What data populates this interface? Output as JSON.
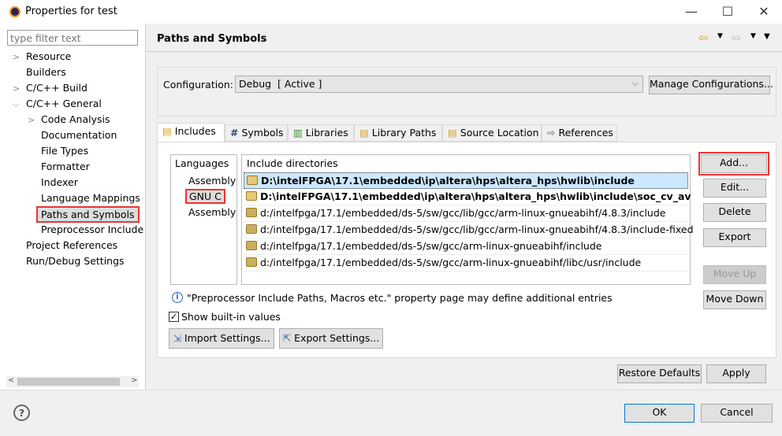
{
  "window": {
    "title": "Properties for test"
  },
  "filter": {
    "placeholder": "type filter text"
  },
  "tree": [
    {
      "label": "Resource",
      "level": 0,
      "chevron": "right"
    },
    {
      "label": "Builders",
      "level": 0,
      "chevron": ""
    },
    {
      "label": "C/C++ Build",
      "level": 0,
      "chevron": "right"
    },
    {
      "label": "C/C++ General",
      "level": 0,
      "chevron": "down"
    },
    {
      "label": "Code Analysis",
      "level": 1,
      "chevron": "right"
    },
    {
      "label": "Documentation",
      "level": 1,
      "chevron": ""
    },
    {
      "label": "File Types",
      "level": 1,
      "chevron": ""
    },
    {
      "label": "Formatter",
      "level": 1,
      "chevron": ""
    },
    {
      "label": "Indexer",
      "level": 1,
      "chevron": ""
    },
    {
      "label": "Language Mappings",
      "level": 1,
      "chevron": ""
    },
    {
      "label": "Paths and Symbols",
      "level": 1,
      "chevron": "",
      "selected": true
    },
    {
      "label": "Preprocessor Include",
      "level": 1,
      "chevron": ""
    },
    {
      "label": "Project References",
      "level": 0,
      "chevron": ""
    },
    {
      "label": "Run/Debug Settings",
      "level": 0,
      "chevron": ""
    }
  ],
  "page": {
    "title": "Paths and Symbols"
  },
  "config": {
    "label": "Configuration:",
    "value": "Debug  [ Active ]",
    "manage": "Manage Configurations..."
  },
  "tabs": [
    "Includes",
    "Symbols",
    "Libraries",
    "Library Paths",
    "Source Location",
    "References"
  ],
  "languages": {
    "header": "Languages",
    "items": [
      "Assembly",
      "GNU C",
      "Assembly"
    ]
  },
  "includes": {
    "header": "Include directories",
    "rows": [
      {
        "path": "D:\\intelFPGA\\17.1\\embedded\\ip\\altera\\hps\\altera_hps\\hwlib\\include",
        "bold": true
      },
      {
        "path": "D:\\intelFPGA\\17.1\\embedded\\ip\\altera\\hps\\altera_hps\\hwlib\\include\\soc_cv_av",
        "bold": true
      },
      {
        "path": "d:/intelfpga/17.1/embedded/ds-5/sw/gcc/lib/gcc/arm-linux-gnueabihf/4.8.3/include",
        "bold": false
      },
      {
        "path": "d:/intelfpga/17.1/embedded/ds-5/sw/gcc/lib/gcc/arm-linux-gnueabihf/4.8.3/include-fixed",
        "bold": false
      },
      {
        "path": "d:/intelfpga/17.1/embedded/ds-5/sw/gcc/arm-linux-gnueabihf/include",
        "bold": false
      },
      {
        "path": "d:/intelfpga/17.1/embedded/ds-5/sw/gcc/arm-linux-gnueabihf/libc/usr/include",
        "bold": false
      }
    ]
  },
  "side_buttons": {
    "add": "Add...",
    "edit": "Edit...",
    "delete": "Delete",
    "export": "Export",
    "move_up": "Move Up",
    "move_down": "Move Down"
  },
  "info": "\"Preprocessor Include Paths, Macros etc.\" property page may define additional entries",
  "show_builtin": {
    "label": "Show built-in values",
    "checked": true
  },
  "import_settings": "Import Settings...",
  "export_settings": "Export Settings...",
  "restore_defaults": "Restore Defaults",
  "apply": "Apply",
  "ok": "OK",
  "cancel": "Cancel",
  "colors": {
    "highlight_box": "#e33333",
    "selection": "#cce8ff"
  }
}
